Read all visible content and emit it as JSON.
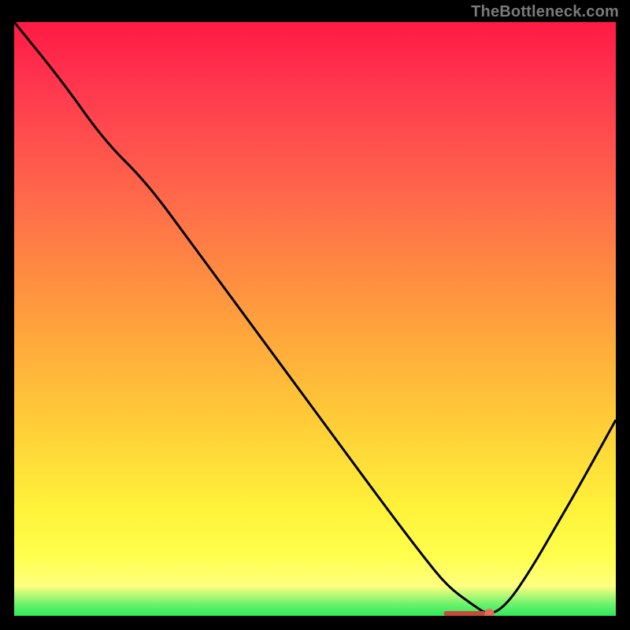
{
  "watermark": "TheBottleneck.com",
  "chart_data": {
    "type": "line",
    "title": "",
    "xlabel": "",
    "ylabel": "",
    "xlim": [
      0,
      100
    ],
    "ylim": [
      0,
      100
    ],
    "grid": false,
    "x": [
      0,
      8,
      15,
      22,
      30,
      38,
      46,
      54,
      62,
      68,
      72,
      76,
      79,
      82,
      86,
      90,
      94,
      100
    ],
    "y": [
      100,
      90,
      80,
      73,
      62,
      51,
      40,
      29,
      18,
      10,
      5,
      2,
      0,
      2,
      8,
      15,
      22,
      33
    ],
    "series": [
      {
        "name": "bottleneck-curve",
        "x": [
          0,
          8,
          15,
          22,
          30,
          38,
          46,
          54,
          62,
          68,
          72,
          76,
          79,
          82,
          86,
          90,
          94,
          100
        ],
        "y": [
          100,
          90,
          80,
          73,
          62,
          51,
          40,
          29,
          18,
          10,
          5,
          2,
          0,
          2,
          8,
          15,
          22,
          33
        ]
      }
    ],
    "annotations": [
      {
        "name": "minimum-marker",
        "x": 79,
        "y": 0
      }
    ]
  }
}
